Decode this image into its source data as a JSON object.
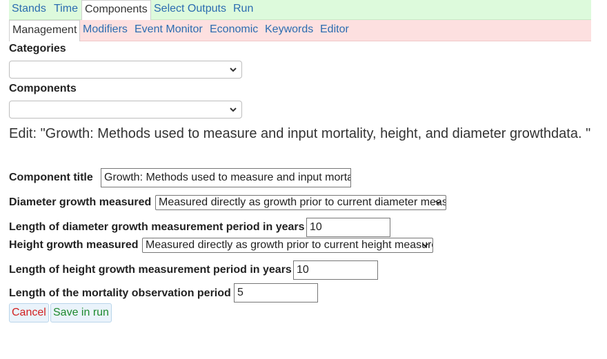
{
  "top_tabs": [
    {
      "label": "Stands",
      "active": false
    },
    {
      "label": "Time",
      "active": false
    },
    {
      "label": "Components",
      "active": true
    },
    {
      "label": "Select Outputs",
      "active": false
    },
    {
      "label": "Run",
      "active": false
    }
  ],
  "sub_tabs": [
    {
      "label": "Management",
      "active": true
    },
    {
      "label": "Modifiers",
      "active": false
    },
    {
      "label": "Event Monitor",
      "active": false
    },
    {
      "label": "Economic",
      "active": false
    },
    {
      "label": "Keywords",
      "active": false
    },
    {
      "label": "Editor",
      "active": false
    }
  ],
  "categories": {
    "label": "Categories",
    "value": ""
  },
  "components": {
    "label": "Components",
    "value": ""
  },
  "edit_heading": "Edit: \"Growth: Methods used to measure and input mortality, height, and diameter growthdata. \"",
  "form": {
    "component_title": {
      "label": "Component title",
      "value": "Growth: Methods used to measure and input mortality, height, and diameter growthdata."
    },
    "diameter_growth": {
      "label": "Diameter growth measured",
      "value": "Measured directly as growth prior to current diameter measurement"
    },
    "diameter_period": {
      "label": "Length of diameter growth measurement period in years",
      "value": "10"
    },
    "height_growth": {
      "label": "Height growth measured",
      "value": "Measured directly as growth prior to current height measurement"
    },
    "height_period": {
      "label": "Length of height growth measurement period in years",
      "value": "10"
    },
    "mortality_period": {
      "label": "Length of the mortality observation period",
      "value": "5"
    }
  },
  "buttons": {
    "cancel": "Cancel",
    "save": "Save in run"
  },
  "colors": {
    "link": "#2b6cb0",
    "cancel": "#d22020",
    "save": "#1e8a2e",
    "top_bar": "#ddfadc",
    "sub_bar": "#fde0e0"
  },
  "icons": {
    "dropdown": "chevron-down-icon"
  }
}
